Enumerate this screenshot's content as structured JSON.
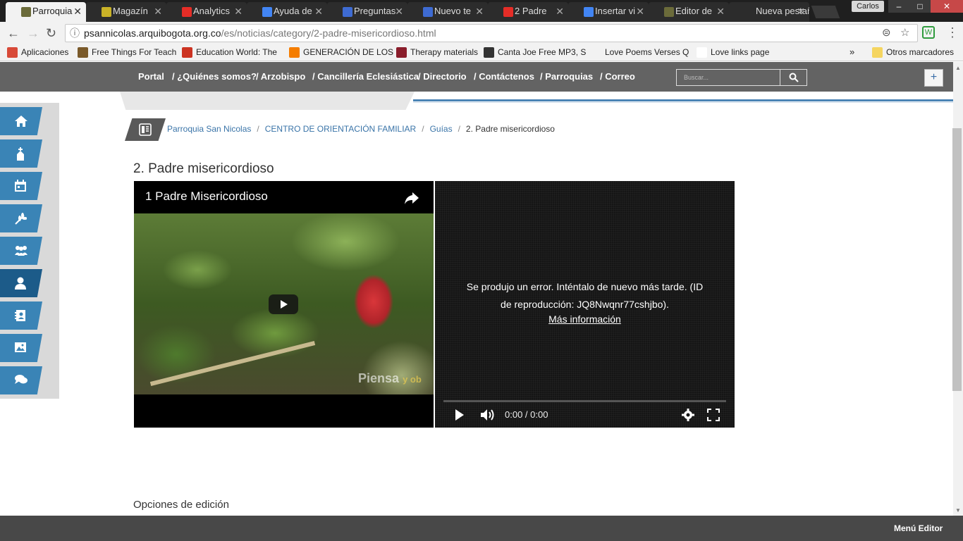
{
  "browser": {
    "tabs": [
      {
        "title": "Parroquia",
        "color": "#6b6b3a",
        "active": true
      },
      {
        "title": "Magazín",
        "color": "#c9b227"
      },
      {
        "title": "Analytics",
        "color": "#e52d27"
      },
      {
        "title": "Ayuda de",
        "color": "#4285f4"
      },
      {
        "title": "Preguntas",
        "color": "#3e6bd2"
      },
      {
        "title": "Nuevo te",
        "color": "#3e6bd2"
      },
      {
        "title": "2 Padre",
        "color": "#e52d27"
      },
      {
        "title": "Insertar vi",
        "color": "#4285f4"
      },
      {
        "title": "Editor de",
        "color": "#6b6b3a"
      },
      {
        "title": "Nueva pestañ",
        "color": "#2c2c2c"
      }
    ],
    "profile": "Carlos",
    "url_host": "psannicolas.arquibogota.org.co",
    "url_path": "/es/noticias/category/2-padre-misericordioso.html",
    "bookmarks": [
      {
        "label": "Aplicaciones",
        "color": "#d84a38"
      },
      {
        "label": "Free Things For Teach",
        "color": "#7a5a2a"
      },
      {
        "label": "Education World: The",
        "color": "#cc3322"
      },
      {
        "label": "GENERACIÓN DE LOS",
        "color": "#f57d00"
      },
      {
        "label": "Therapy materials",
        "color": "#8a1d2b"
      },
      {
        "label": "Canta Joe Free MP3, S",
        "color": "#333333"
      },
      {
        "label": "Love Poems Verses Q",
        "color": "#f2f2f2"
      },
      {
        "label": "Love links page",
        "color": "#ffffff"
      }
    ],
    "bookmarks_more": "»",
    "other_bookmarks": "Otros marcadores"
  },
  "site": {
    "nav": [
      "Portal",
      "/ ¿Quiénes somos?",
      "/ Arzobispo",
      "/ Cancillería Eclesiástica",
      "/ Directorio",
      "/ Contáctenos",
      "/ Parroquias",
      "/ Correo"
    ],
    "search_placeholder": "Buscar...",
    "plus": "+",
    "sidebar_icons": [
      "home-icon",
      "church-icon",
      "calendar-icon",
      "wheat-icon",
      "group-icon",
      "user-icon",
      "contacts-icon",
      "image-icon",
      "chat-icon"
    ],
    "breadcrumb": {
      "items": [
        "Parroquia San Nicolas",
        "CENTRO DE ORIENTACIÓN FAMILIAR",
        "Guías"
      ],
      "current": "2. Padre misericordioso"
    },
    "page_title": "2. Padre misericordioso",
    "video1": {
      "title": "1 Padre Misericordioso",
      "watermark": "Piensa",
      "watermark_small": "y ob"
    },
    "video2": {
      "error": "Se produjo un error. Inténtalo de nuevo más tarde. (ID de reproducción: JQ8Nwqnr77cshjbo).",
      "link": "Más información",
      "time": "0:00 / 0:00"
    },
    "edit_options": "Opciones de edición",
    "footer_menu": "Menú Editor"
  }
}
